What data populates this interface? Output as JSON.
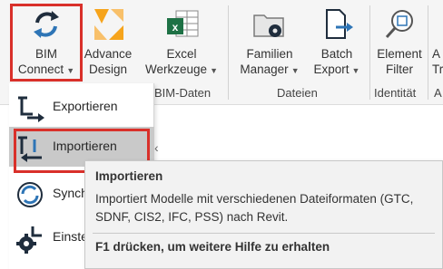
{
  "ribbon": {
    "buttons": [
      {
        "id": "bim-connect",
        "line1": "BIM",
        "line2": "Connect",
        "icon": "sync-arrows-icon",
        "dropdown": true
      },
      {
        "id": "advance-design",
        "line1": "Advance",
        "line2": "Design",
        "icon": "advance-design-logo-icon",
        "dropdown": false
      },
      {
        "id": "excel-werkzeuge",
        "line1": "Excel",
        "line2": "Werkzeuge",
        "icon": "excel-table-icon",
        "dropdown": true
      },
      {
        "id": "familien-manager",
        "line1": "Familien",
        "line2": "Manager",
        "icon": "folder-gear-icon",
        "dropdown": true
      },
      {
        "id": "batch-export",
        "line1": "Batch",
        "line2": "Export",
        "icon": "document-export-icon",
        "dropdown": true
      },
      {
        "id": "element-filter",
        "line1": "Element",
        "line2": "Filter",
        "icon": "magnifier-icon",
        "dropdown": false
      },
      {
        "id": "partial-next",
        "line1": "A",
        "line2": "Tr",
        "icon": "",
        "dropdown": false
      }
    ],
    "groups": [
      "BIM-Daten",
      "Dateien",
      "Identität",
      "A"
    ]
  },
  "menu": {
    "items": [
      {
        "label": "Exportieren",
        "icon": "export-arrow-icon",
        "active": false
      },
      {
        "label": "Importieren",
        "icon": "import-arrow-icon",
        "active": true
      },
      {
        "label": "Synch",
        "icon": "sync-circle-icon",
        "active": false
      },
      {
        "label": "Einste",
        "icon": "settings-gear-icon",
        "active": false
      }
    ]
  },
  "tooltip": {
    "title": "Importieren",
    "description": "Importiert Modelle mit verschiedenen Dateiformaten (GTC, SDNF, CIS2, IFC, PSS) nach Revit.",
    "help": "F1 drücken, um weitere Hilfe zu erhalten"
  },
  "colors": {
    "highlight": "#d9302a",
    "ribbon_bg": "#f5f5f5",
    "menu_active": "#c9c9c9",
    "icon_blue": "#2e75b6",
    "icon_dark": "#1f2d3d"
  }
}
